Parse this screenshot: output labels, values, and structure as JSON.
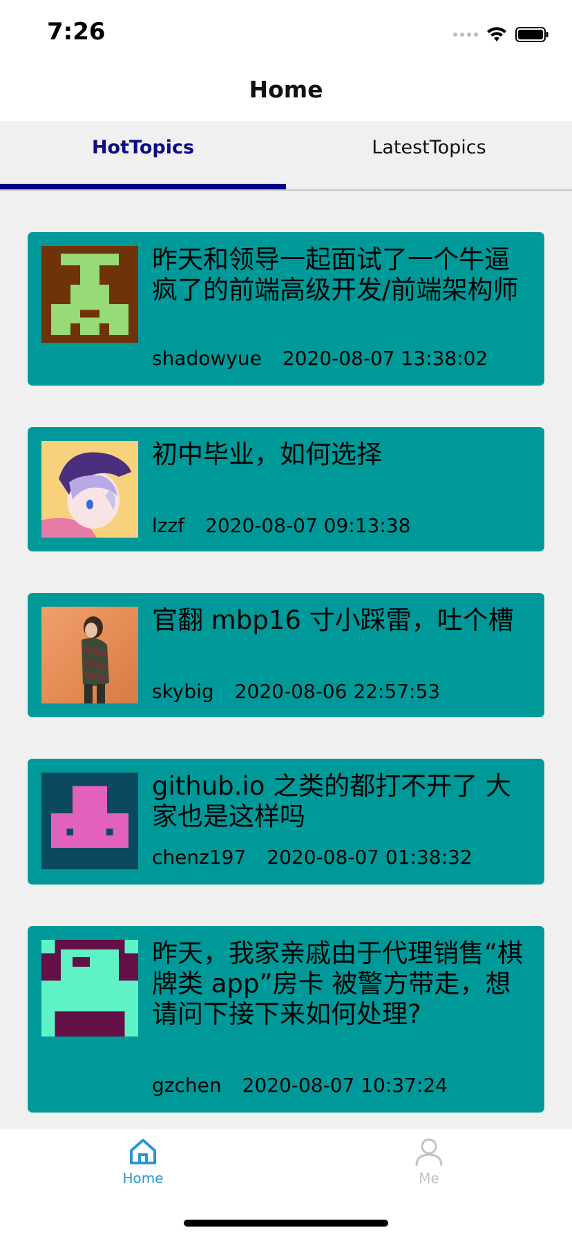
{
  "status_bar": {
    "time": "7:26",
    "icons": [
      "signal-icon",
      "wifi-icon",
      "battery-icon"
    ]
  },
  "header": {
    "title": "Home"
  },
  "top_tabs": [
    {
      "label": "HotTopics",
      "selected": true
    },
    {
      "label": "LatestTopics",
      "selected": false
    }
  ],
  "colors": {
    "card_background": "#009999",
    "tab_active": "#0d0d86",
    "bottom_tab_active": "#2b95d6",
    "bottom_tab_inactive": "#c2c2c2"
  },
  "topics": [
    {
      "title": "昨天和领导一起面试了一个牛逼疯了的前端高级开发/前端架构师",
      "author": "shadowyue",
      "date": "2020-08-07 13:38:02",
      "avatar": "green-pixel-avatar"
    },
    {
      "title": "初中毕业，如何选择",
      "author": "lzzf",
      "date": "2020-08-07 09:13:38",
      "avatar": "anime-character-avatar"
    },
    {
      "title": "官翻 mbp16 寸小踩雷，吐个槽",
      "author": "skybig",
      "date": "2020-08-06 22:57:53",
      "avatar": "photo-person-avatar"
    },
    {
      "title": "github.io 之类的都打不开了 大家也是这样吗",
      "author": "chenz197",
      "date": "2020-08-07 01:38:32",
      "avatar": "pink-pixel-avatar"
    },
    {
      "title": "昨天，我家亲戚由于代理销售“棋牌类 app”房卡 被警方带走，想请问下接下来如何处理?",
      "author": "gzchen",
      "date": "2020-08-07 10:37:24",
      "avatar": "mint-pixel-avatar"
    }
  ],
  "bottom_tabs": [
    {
      "label": "Home",
      "icon": "home-icon",
      "selected": true
    },
    {
      "label": "Me",
      "icon": "user-icon",
      "selected": false
    }
  ]
}
